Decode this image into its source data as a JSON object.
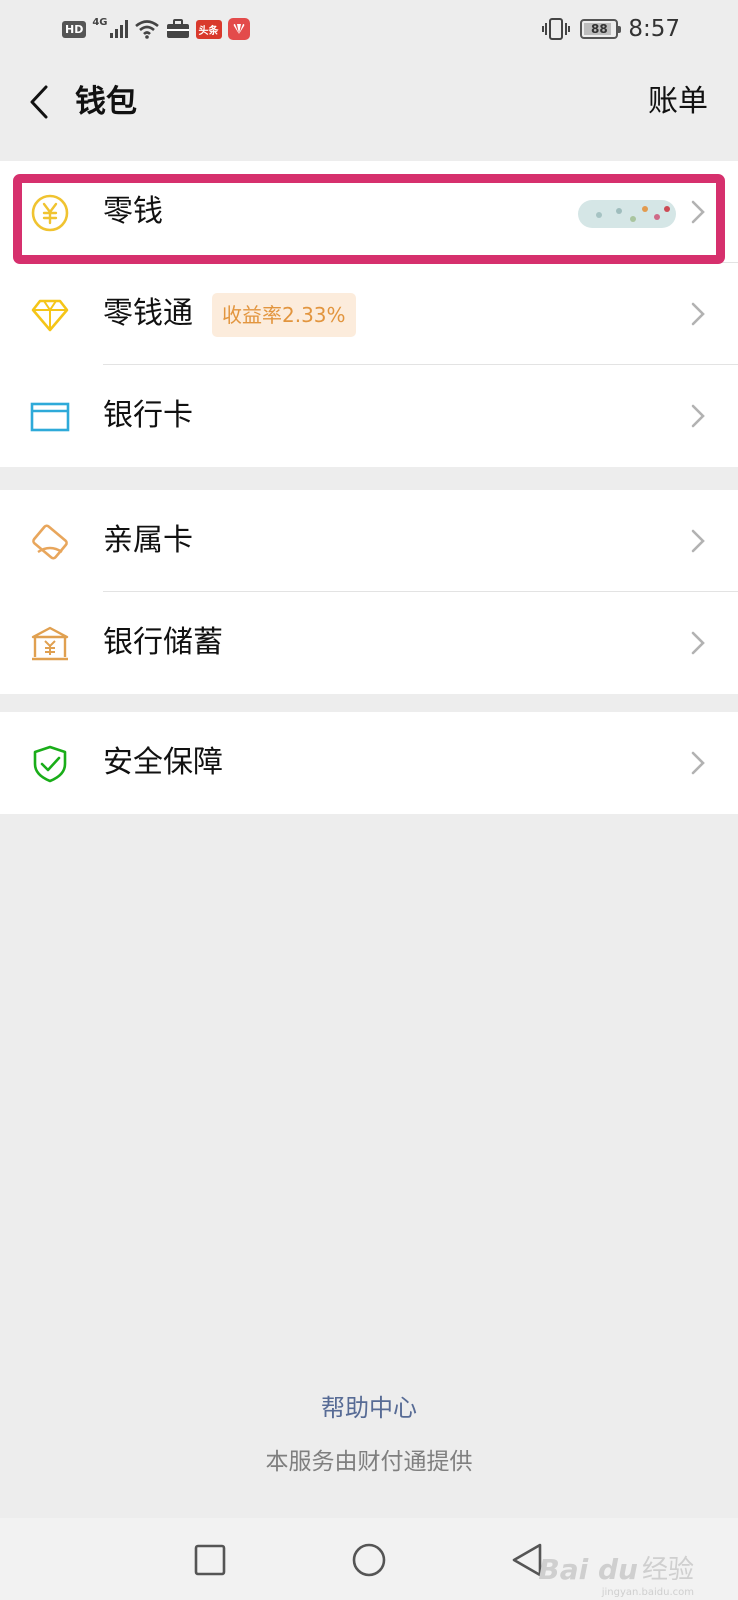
{
  "status_bar": {
    "hd": "HD",
    "network": "4G",
    "app_badge": "头条",
    "battery": "88",
    "battery_level": 0.88,
    "time": "8:57"
  },
  "nav": {
    "title": "钱包",
    "bill_label": "账单",
    "back_icon": "chevron-left-icon"
  },
  "groups": [
    {
      "items": [
        {
          "label": "零钱",
          "icon": "yuan-coin-icon",
          "icon_color": "#f0c330"
        },
        {
          "label": "零钱通",
          "badge": "收益率2.33%",
          "icon": "diamond-icon",
          "icon_color": "#f5c518"
        },
        {
          "label": "银行卡",
          "icon": "card-icon",
          "icon_color": "#2eaad9"
        }
      ]
    },
    {
      "items": [
        {
          "label": "亲属卡",
          "icon": "family-card-icon",
          "icon_color": "#e8a65c"
        },
        {
          "label": "银行储蓄",
          "icon": "bank-savings-icon",
          "icon_color": "#e0a050"
        }
      ]
    },
    {
      "items": [
        {
          "label": "安全保障",
          "icon": "shield-check-icon",
          "icon_color": "#1aad19"
        }
      ]
    }
  ],
  "footer": {
    "help_link": "帮助中心",
    "provider_text": "本服务由财付通提供"
  },
  "watermark": {
    "logo": "Bai du",
    "text": "经验",
    "sub": "jingyan.baidu.com"
  },
  "colors": {
    "highlight": "#d6306d",
    "link": "#576b95",
    "badge_bg": "#fcecdc",
    "badge_text": "#e2953e"
  }
}
